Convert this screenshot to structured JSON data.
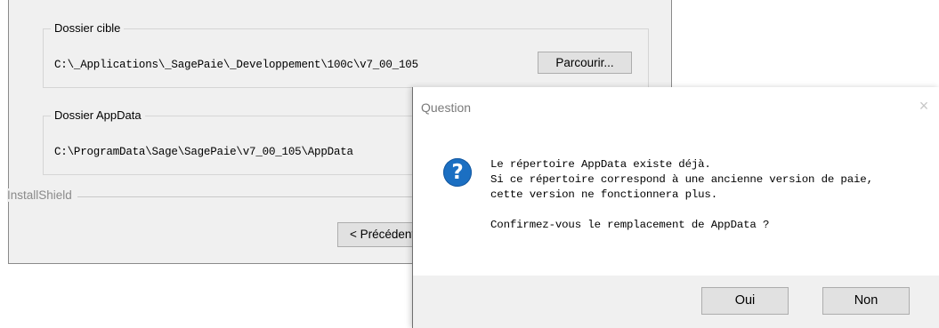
{
  "installer": {
    "target_folder": {
      "legend": "Dossier cible",
      "path": "C:\\_Applications\\_SagePaie\\_Developpement\\100c\\v7_00_105",
      "browse_label": "Parcourir..."
    },
    "appdata_folder": {
      "legend": "Dossier AppData",
      "path": "C:\\ProgramData\\Sage\\SagePaie\\v7_00_105\\AppData"
    },
    "brand_label": "InstallShield",
    "prev_label": "< Précédent"
  },
  "dialog": {
    "title": "Question",
    "close_glyph": "×",
    "icon": "question-icon",
    "icon_glyph": "?",
    "message_lines": [
      "Le répertoire AppData existe déjà.",
      "Si ce répertoire correspond à une ancienne version de paie,",
      "cette version ne fonctionnera plus."
    ],
    "confirm_line": "Confirmez-vous le remplacement de AppData ?",
    "yes_label": "Oui",
    "no_label": "Non"
  },
  "colors": {
    "window_bg": "#f0f0f0",
    "dialog_bg": "#ffffff",
    "icon_blue": "#1b6fc2",
    "button_bg": "#e1e1e1"
  }
}
